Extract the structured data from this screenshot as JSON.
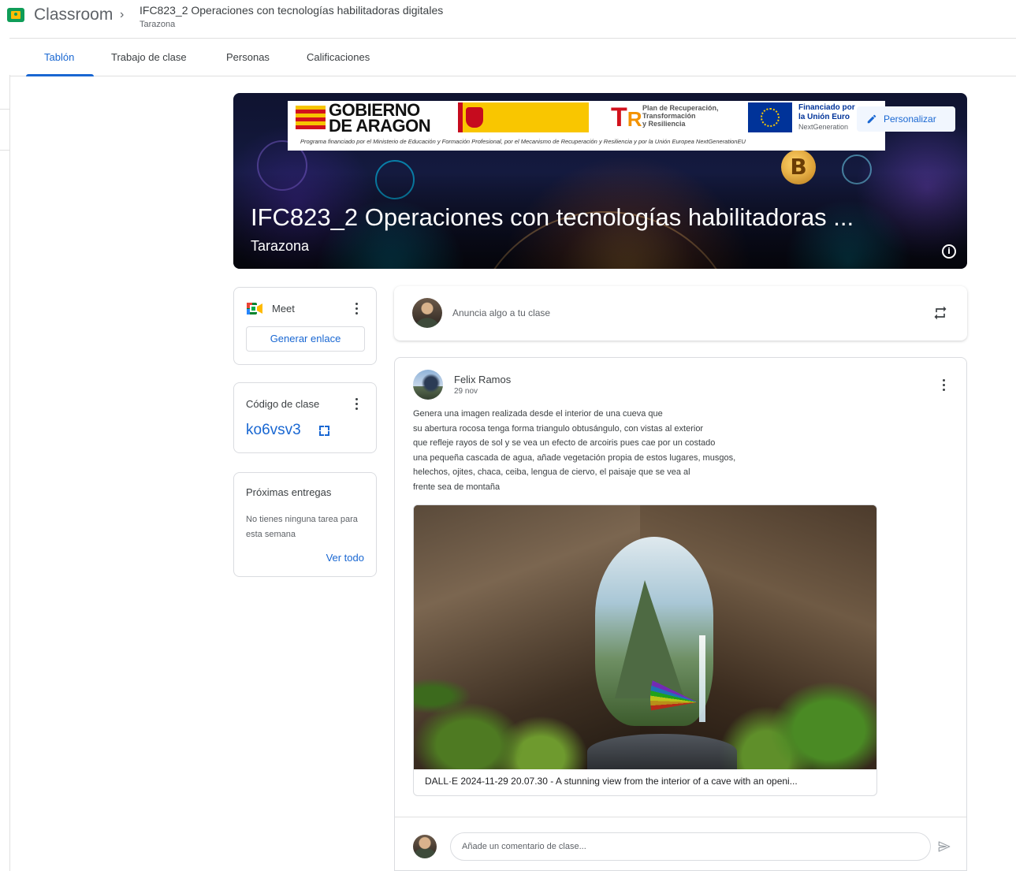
{
  "app": {
    "name": "Classroom",
    "breadcrumb_title": "IFC823_2 Operaciones con tecnologías habilitadoras digitales",
    "breadcrumb_subtitle": "Tarazona",
    "logo_icon": "google-classroom-icon"
  },
  "tabs": [
    {
      "label": "Tablón",
      "active": true
    },
    {
      "label": "Trabajo de clase",
      "active": false
    },
    {
      "label": "Personas",
      "active": false
    },
    {
      "label": "Calificaciones",
      "active": false
    }
  ],
  "banner": {
    "title": "IFC823_2 Operaciones con tecnologías habilitadoras ...",
    "subtitle": "Tarazona",
    "customize_label": "Personalizar",
    "logos": {
      "aragon_line1": "GOBIERNO",
      "aragon_line2": "DE ARAGON",
      "prtr_line1": "Plan de Recuperación,",
      "prtr_line2": "Transformación",
      "prtr_line3": "y Resiliencia",
      "eu_line1": "Financiado por",
      "eu_line2": "la Unión Euro",
      "eu_line3": "NextGeneration",
      "caption": "Programa financiado por el Ministerio de Educación y Formación Profesional, por el Mecanismo de Recuperación y Resiliencia y por la Unión Europea NextGenerationEU"
    }
  },
  "meet": {
    "label": "Meet",
    "button_label": "Generar enlace"
  },
  "class_code": {
    "label": "Código de clase",
    "value": "ko6vsv3"
  },
  "upcoming": {
    "title": "Próximas entregas",
    "empty_text": "No tienes ninguna tarea para esta semana",
    "link_label": "Ver todo"
  },
  "announce": {
    "placeholder": "Anuncia algo a tu clase"
  },
  "post": {
    "author": "Felix Ramos",
    "date": "29 nov",
    "body_lines": [
      "Genera una imagen realizada desde el interior de una cueva que",
      "su abertura rocosa tenga forma triangulo obtusángulo, con vistas al exterior",
      "que refleje rayos de sol y se vea un efecto de arcoiris pues cae por un costado",
      "una pequeña cascada de agua, añade vegetación propia de estos lugares, musgos,",
      "helechos, ojites, chaca, ceiba, lengua de ciervo, el paisaje que se vea al",
      "frente sea de montaña"
    ],
    "attachment_caption": "DALL·E 2024-11-29 20.07.30 - A stunning view from the interior of a cave with an openi...",
    "comment_placeholder": "Añade un comentario de clase..."
  },
  "colors": {
    "accent": "#1967d2",
    "text": "#3c4043",
    "muted": "#5f6368",
    "border": "#dadce0"
  }
}
